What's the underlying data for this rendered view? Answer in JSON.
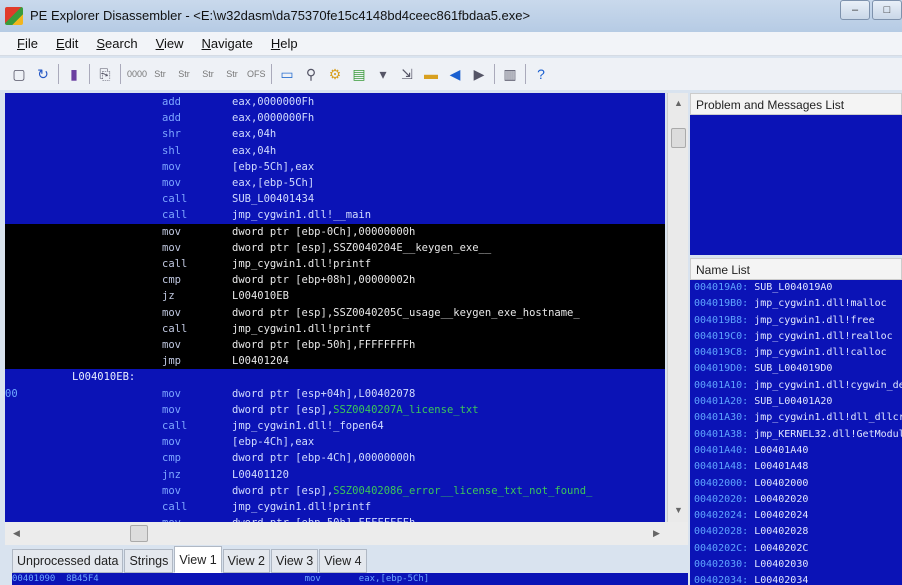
{
  "window": {
    "title": "PE Explorer Disassembler - <E:\\w32dasm\\da75370fe15c4148bd4ceec861fbdaa5.exe>",
    "minimize": "–",
    "maximize": "□"
  },
  "menu": [
    {
      "label": "File",
      "key": "F",
      "rest": "ile"
    },
    {
      "label": "Edit",
      "key": "E",
      "rest": "dit"
    },
    {
      "label": "Search",
      "key": "S",
      "rest": "earch"
    },
    {
      "label": "View",
      "key": "V",
      "rest": "iew"
    },
    {
      "label": "Navigate",
      "key": "N",
      "rest": "avigate"
    },
    {
      "label": "Help",
      "key": "H",
      "rest": "elp"
    }
  ],
  "toolbar": [
    "new-icon",
    "refresh-icon",
    "save-icon",
    "copy-icon",
    "hex-icon",
    "str-icon",
    "pstr-icon",
    "ustr-icon",
    "ucstr-icon",
    "ofs-icon",
    "window-icon",
    "search-icon",
    "tools-icon",
    "export-icon",
    "dropdown-icon",
    "goto-icon",
    "open-icon",
    "back-icon",
    "forward-icon",
    "panels-icon",
    "help-icon"
  ],
  "toolbar_text": {
    "hex": "0000",
    "str": "Str",
    "ofs": "OFS"
  },
  "code": [
    {
      "mn": "add",
      "op": "eax,0000000Fh",
      "sel": false
    },
    {
      "mn": "add",
      "op": "eax,0000000Fh",
      "sel": false
    },
    {
      "mn": "shr",
      "op": "eax,04h",
      "sel": false
    },
    {
      "mn": "shl",
      "op": "eax,04h",
      "sel": false
    },
    {
      "mn": "mov",
      "op": "[ebp-5Ch],eax",
      "sel": false
    },
    {
      "mn": "mov",
      "op": "eax,[ebp-5Ch]",
      "sel": false
    },
    {
      "mn": "call",
      "op": "SUB_L00401434",
      "sel": false
    },
    {
      "mn": "call",
      "op": "jmp_cygwin1.dll!__main",
      "sel": false
    },
    {
      "mn": "mov",
      "op": "dword ptr [ebp-0Ch],00000000h",
      "sel": true
    },
    {
      "mn": "mov",
      "op": "dword ptr [esp],SSZ0040204E__keygen_exe__",
      "sel": true
    },
    {
      "mn": "call",
      "op": "jmp_cygwin1.dll!printf",
      "sel": true
    },
    {
      "mn": "cmp",
      "op": "dword ptr [ebp+08h],00000002h",
      "sel": true
    },
    {
      "mn": "jz",
      "op": "L004010EB",
      "sel": true
    },
    {
      "mn": "mov",
      "op": "dword ptr [esp],SSZ0040205C_usage__keygen_exe_hostname_",
      "sel": true
    },
    {
      "mn": "call",
      "op": "jmp_cygwin1.dll!printf",
      "sel": true
    },
    {
      "mn": "mov",
      "op": "dword ptr [ebp-50h],FFFFFFFFh",
      "sel": true
    },
    {
      "mn": "jmp",
      "op": "L00401204",
      "sel": true
    },
    {
      "label": "L004010EB:"
    },
    {
      "addr": "00",
      "mn": "mov",
      "op": "dword ptr [esp+04h],L00402078",
      "sel": false
    },
    {
      "mn": "mov",
      "op": "dword ptr [esp],",
      "str": "SSZ0040207A_license_txt",
      "sel": false
    },
    {
      "mn": "call",
      "op": "jmp_cygwin1.dll!_fopen64",
      "sel": false
    },
    {
      "mn": "mov",
      "op": "[ebp-4Ch],eax",
      "sel": false
    },
    {
      "mn": "cmp",
      "op": "dword ptr [ebp-4Ch],00000000h",
      "sel": false
    },
    {
      "mn": "jnz",
      "op": "L00401120",
      "sel": false
    },
    {
      "mn": "mov",
      "op": "dword ptr [esp],",
      "str": "SSZ00402086_error__license_txt_not_found_",
      "sel": false
    },
    {
      "mn": "call",
      "op": "jmp_cygwin1.dll!printf",
      "sel": false
    },
    {
      "mn": "mov",
      "op": "dword ptr [ebp-50h],FFFFFFFFh",
      "sel": false
    }
  ],
  "tabs": [
    {
      "label": "Unprocessed data"
    },
    {
      "label": "Strings"
    },
    {
      "label": "View 1",
      "active": true
    },
    {
      "label": "View 2"
    },
    {
      "label": "View 3"
    },
    {
      "label": "View 4"
    }
  ],
  "bottom_row": "00401090  8B45F4                                      mov       eax,[ebp-5Ch]",
  "problems": {
    "title": "Problem and Messages List"
  },
  "names": {
    "title": "Name List",
    "items": [
      {
        "a": "004019A0:",
        "n": "SUB_L004019A0"
      },
      {
        "a": "004019B0:",
        "n": "jmp_cygwin1.dll!malloc"
      },
      {
        "a": "004019B8:",
        "n": "jmp_cygwin1.dll!free"
      },
      {
        "a": "004019C0:",
        "n": "jmp_cygwin1.dll!realloc"
      },
      {
        "a": "004019C8:",
        "n": "jmp_cygwin1.dll!calloc"
      },
      {
        "a": "004019D0:",
        "n": "SUB_L004019D0"
      },
      {
        "a": "00401A10:",
        "n": "jmp_cygwin1.dll!cygwin_de"
      },
      {
        "a": "00401A20:",
        "n": "SUB_L00401A20"
      },
      {
        "a": "00401A30:",
        "n": "jmp_cygwin1.dll!dll_dllcr"
      },
      {
        "a": "00401A38:",
        "n": "jmp_KERNEL32.dll!GetModul"
      },
      {
        "a": "00401A40:",
        "n": "L00401A40"
      },
      {
        "a": "00401A48:",
        "n": "L00401A48"
      },
      {
        "a": "00402000:",
        "n": "L00402000"
      },
      {
        "a": "00402020:",
        "n": "L00402020"
      },
      {
        "a": "00402024:",
        "n": "L00402024"
      },
      {
        "a": "00402028:",
        "n": "L00402028"
      },
      {
        "a": "0040202C:",
        "n": "L0040202C"
      },
      {
        "a": "00402030:",
        "n": "L00402030"
      },
      {
        "a": "00402034:",
        "n": "L00402034"
      }
    ]
  },
  "colors": {
    "code_bg": "#0b13b6",
    "selection_bg": "#000000",
    "string": "#3cc65a"
  }
}
